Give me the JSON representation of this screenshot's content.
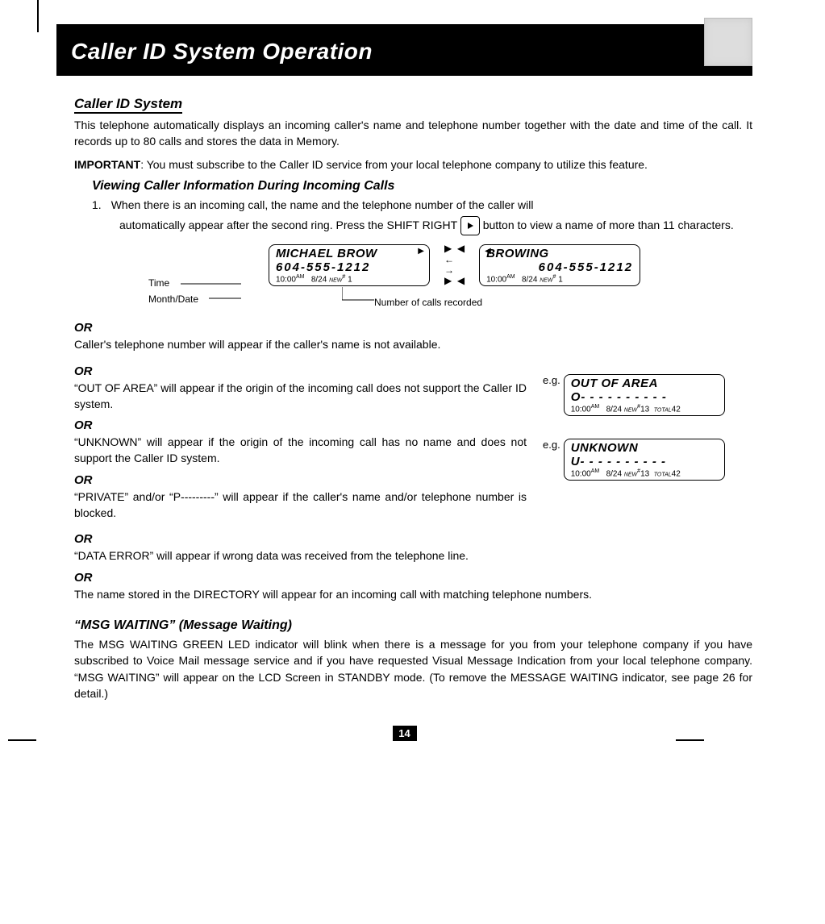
{
  "banner_title": "Caller ID System Operation",
  "h_caller_id": "Caller ID System",
  "p_intro": "This telephone automatically displays an incoming caller's name and telephone number together with the date and time of the call. It records up to 80 calls and stores the data in Memory.",
  "p_important_label": "IMPORTANT",
  "p_important": ": You must subscribe to the Caller ID service from your local telephone company to utilize this feature.",
  "h_viewing": "Viewing Caller Information During Incoming Calls",
  "step1_num": "1.",
  "step1a": "When there is an incoming call, the name and the telephone number of the caller will",
  "step1b_pre": "automatically appear after the second ring. Press the SHIFT RIGHT ",
  "step1b_post": " button to view a name of more than 11 characters.",
  "label_time": "Time",
  "label_monthdate": "Month/Date",
  "label_numcalls": "Number of calls recorded",
  "lcd1_l1": "MICHAEL BROW",
  "lcd1_l2": "604-555-1212",
  "lcd1_time": "10:00",
  "lcd1_ampm": "AM",
  "lcd1_date": "8/24",
  "lcd1_newlabel": "NEW",
  "lcd1_hash": "#",
  "lcd1_count": "1",
  "lcd2_l1": "BROWING",
  "lcd2_l2": "604-555-1212",
  "or": "OR",
  "p_or1": "Caller's telephone number will appear if the caller's name is not available.",
  "p_or2": "“OUT OF AREA” will appear if the origin of the incoming call does not support the Caller ID system.",
  "p_or3": "“UNKNOWN” will appear if the origin of the incoming call has no name and does not support the Caller ID system.",
  "p_or4": "“PRIVATE” and/or “P---------” will appear if the caller's name and/or telephone number is blocked.",
  "p_or5": "“DATA ERROR” will appear if wrong data was received from the telephone line.",
  "p_or6": "The name stored in the DIRECTORY will appear for an incoming call with matching telephone numbers.",
  "eg": "e.g.",
  "lcd_oa_l1": "OUT  OF  AREA",
  "lcd_oa_l2": "O- - - - - -  - - - -",
  "lcd_oa_time": "10:00",
  "lcd_oa_ampm": "AM",
  "lcd_oa_date": "8/24",
  "lcd_oa_new": "NEW",
  "lcd_oa_hash": "#",
  "lcd_oa_newn": "13",
  "lcd_oa_totlabel": "TOTAL",
  "lcd_oa_tot": "42",
  "lcd_uk_l1": "UNKNOWN",
  "lcd_uk_l2": "U- - - - - -  - - - -",
  "h_msg": "“MSG WAITING” (Message Waiting)",
  "p_msg": "The MSG WAITING GREEN LED indicator will blink when there is a message for you from your telephone company if you have subscribed to Voice Mail message service and if you have requested Visual Message Indication from your local telephone company. “MSG WAITING” will appear on the LCD Screen in STANDBY mode. (To remove the MESSAGE WAITING indicator, see page 26 for detail.)",
  "page_num": "14"
}
